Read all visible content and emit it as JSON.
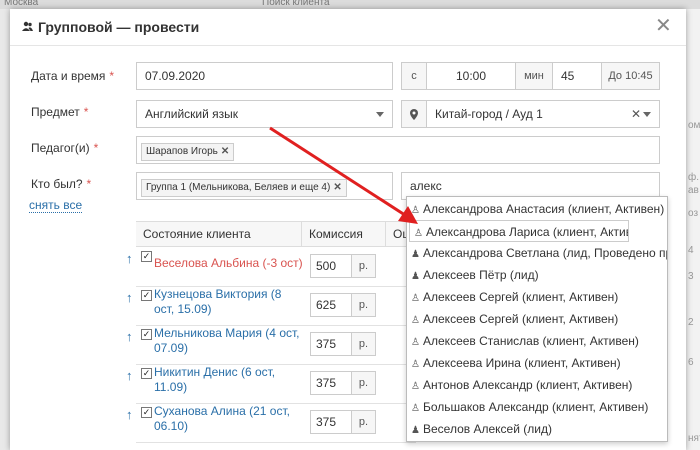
{
  "background": {
    "top_items": [
      "Москва",
      "Поиск клиента"
    ],
    "right_items": [
      "ом.",
      "ф.",
      "ав",
      "оз",
      "4",
      "3",
      "2",
      "6",
      "нят"
    ]
  },
  "modal": {
    "title": "Групповой — провести",
    "fields": {
      "datetime": {
        "label": "Дата и время",
        "date": "07.09.2020",
        "from_label": "с",
        "time": "10:00",
        "min_label": "мин",
        "minutes": "45",
        "until": "До 10:45"
      },
      "subject": {
        "label": "Предмет",
        "value": "Английский язык",
        "location": "Китай-город / Ауд 1"
      },
      "teacher": {
        "label": "Педагог(и)",
        "tag": "Шарапов Игорь"
      },
      "attendance": {
        "label": "Кто был?",
        "group_tag": "Группа 1 (Мельникова, Беляев и еще 4)",
        "search": "алекс",
        "reset": "снять все"
      }
    },
    "table": {
      "headers": [
        "Состояние клиента",
        "Комиссия",
        "Оц"
      ],
      "currency": "р.",
      "rows": [
        {
          "name": "Веселова Альбина (-3 ост)",
          "commission": "500",
          "color": "#d9534f"
        },
        {
          "name": "Кузнецова Виктория (8 ост, 15.09)",
          "commission": "625",
          "color": "#2a6fa8"
        },
        {
          "name": "Мельникова Мария (4 ост, 07.09)",
          "commission": "375",
          "color": "#2a6fa8"
        },
        {
          "name": "Никитин Денис (6 ост, 11.09)",
          "commission": "375",
          "color": "#2a6fa8"
        },
        {
          "name": "Суханова Алина (21 ост, 06.10)",
          "commission": "375",
          "color": "#2a6fa8"
        }
      ]
    }
  },
  "dropdown": {
    "items": [
      {
        "icon": "person-icon",
        "text": "Александрова Анастасия (клиент, Активен)"
      },
      {
        "icon": "person-icon",
        "text": "Александрова Лариса (клиент, Активен)"
      },
      {
        "icon": "lead-icon",
        "text": "Александрова Светлана (лид, Проведено пробное)"
      },
      {
        "icon": "lead-icon",
        "text": "Алексеев Пётр (лид)"
      },
      {
        "icon": "person-icon",
        "text": "Алексеев Сергей (клиент, Активен)"
      },
      {
        "icon": "person-icon",
        "text": "Алексеев Сергей (клиент, Активен)"
      },
      {
        "icon": "person-icon",
        "text": "Алексеев Станислав (клиент, Активен)"
      },
      {
        "icon": "person-icon",
        "text": "Алексеева Ирина (клиент, Активен)"
      },
      {
        "icon": "person-icon",
        "text": "Антонов Александр (клиент, Активен)"
      },
      {
        "icon": "person-icon",
        "text": "Большаков Александр (клиент, Активен)"
      },
      {
        "icon": "lead-icon",
        "text": "Веселов Алексей (лид)"
      }
    ]
  },
  "accent_colors": {
    "link": "#2a6fa8",
    "negative": "#d9534f",
    "annotation_arrow": "#e02020"
  }
}
